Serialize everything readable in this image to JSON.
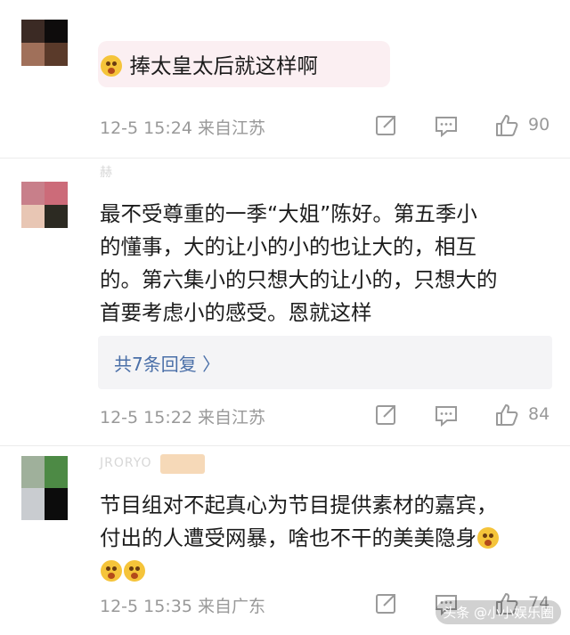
{
  "comments": [
    {
      "username": "",
      "text": "捧太皇太后就这样啊",
      "timestamp": "12-5 15:24 来自江苏",
      "likes": "90",
      "avatar_colors": [
        "#3b2a24",
        "#0e0c0c",
        "#a0705a",
        "#5a3a2a"
      ],
      "bubble_color": "#fbeff2"
    },
    {
      "username": "赫",
      "text_lines": [
        "最不受尊重的一季“大姐”陈好。第五季小",
        "的懂事，大的让小的小的也让大的，相互",
        "的。第六集小的只想大的让小的，只想大的",
        "首要考虑小的感受。恩就这样"
      ],
      "replies_label": "共7条回复 〉",
      "timestamp": "12-5 15:22 来自江苏",
      "likes": "84",
      "avatar_colors": [
        "#c87f8a",
        "#cc6b79",
        "#e8c6b4",
        "#2c2a22"
      ]
    },
    {
      "username": "JRORYO",
      "text_lines": [
        "节目组对不起真心为节目提供素材的嘉宾，",
        "付出的人遭受网暴，啥也不干的美美隐身"
      ],
      "timestamp": "12-5 15:35 来自广东",
      "likes": "74",
      "avatar_colors": [
        "#9fb09b",
        "#4d8a45",
        "#c9ccd0",
        "#0c0c0c"
      ]
    }
  ],
  "watermark": "头条 @小小娱乐圈",
  "icons": [
    "share-icon",
    "comment-icon",
    "like-icon",
    "emoji-icon"
  ]
}
